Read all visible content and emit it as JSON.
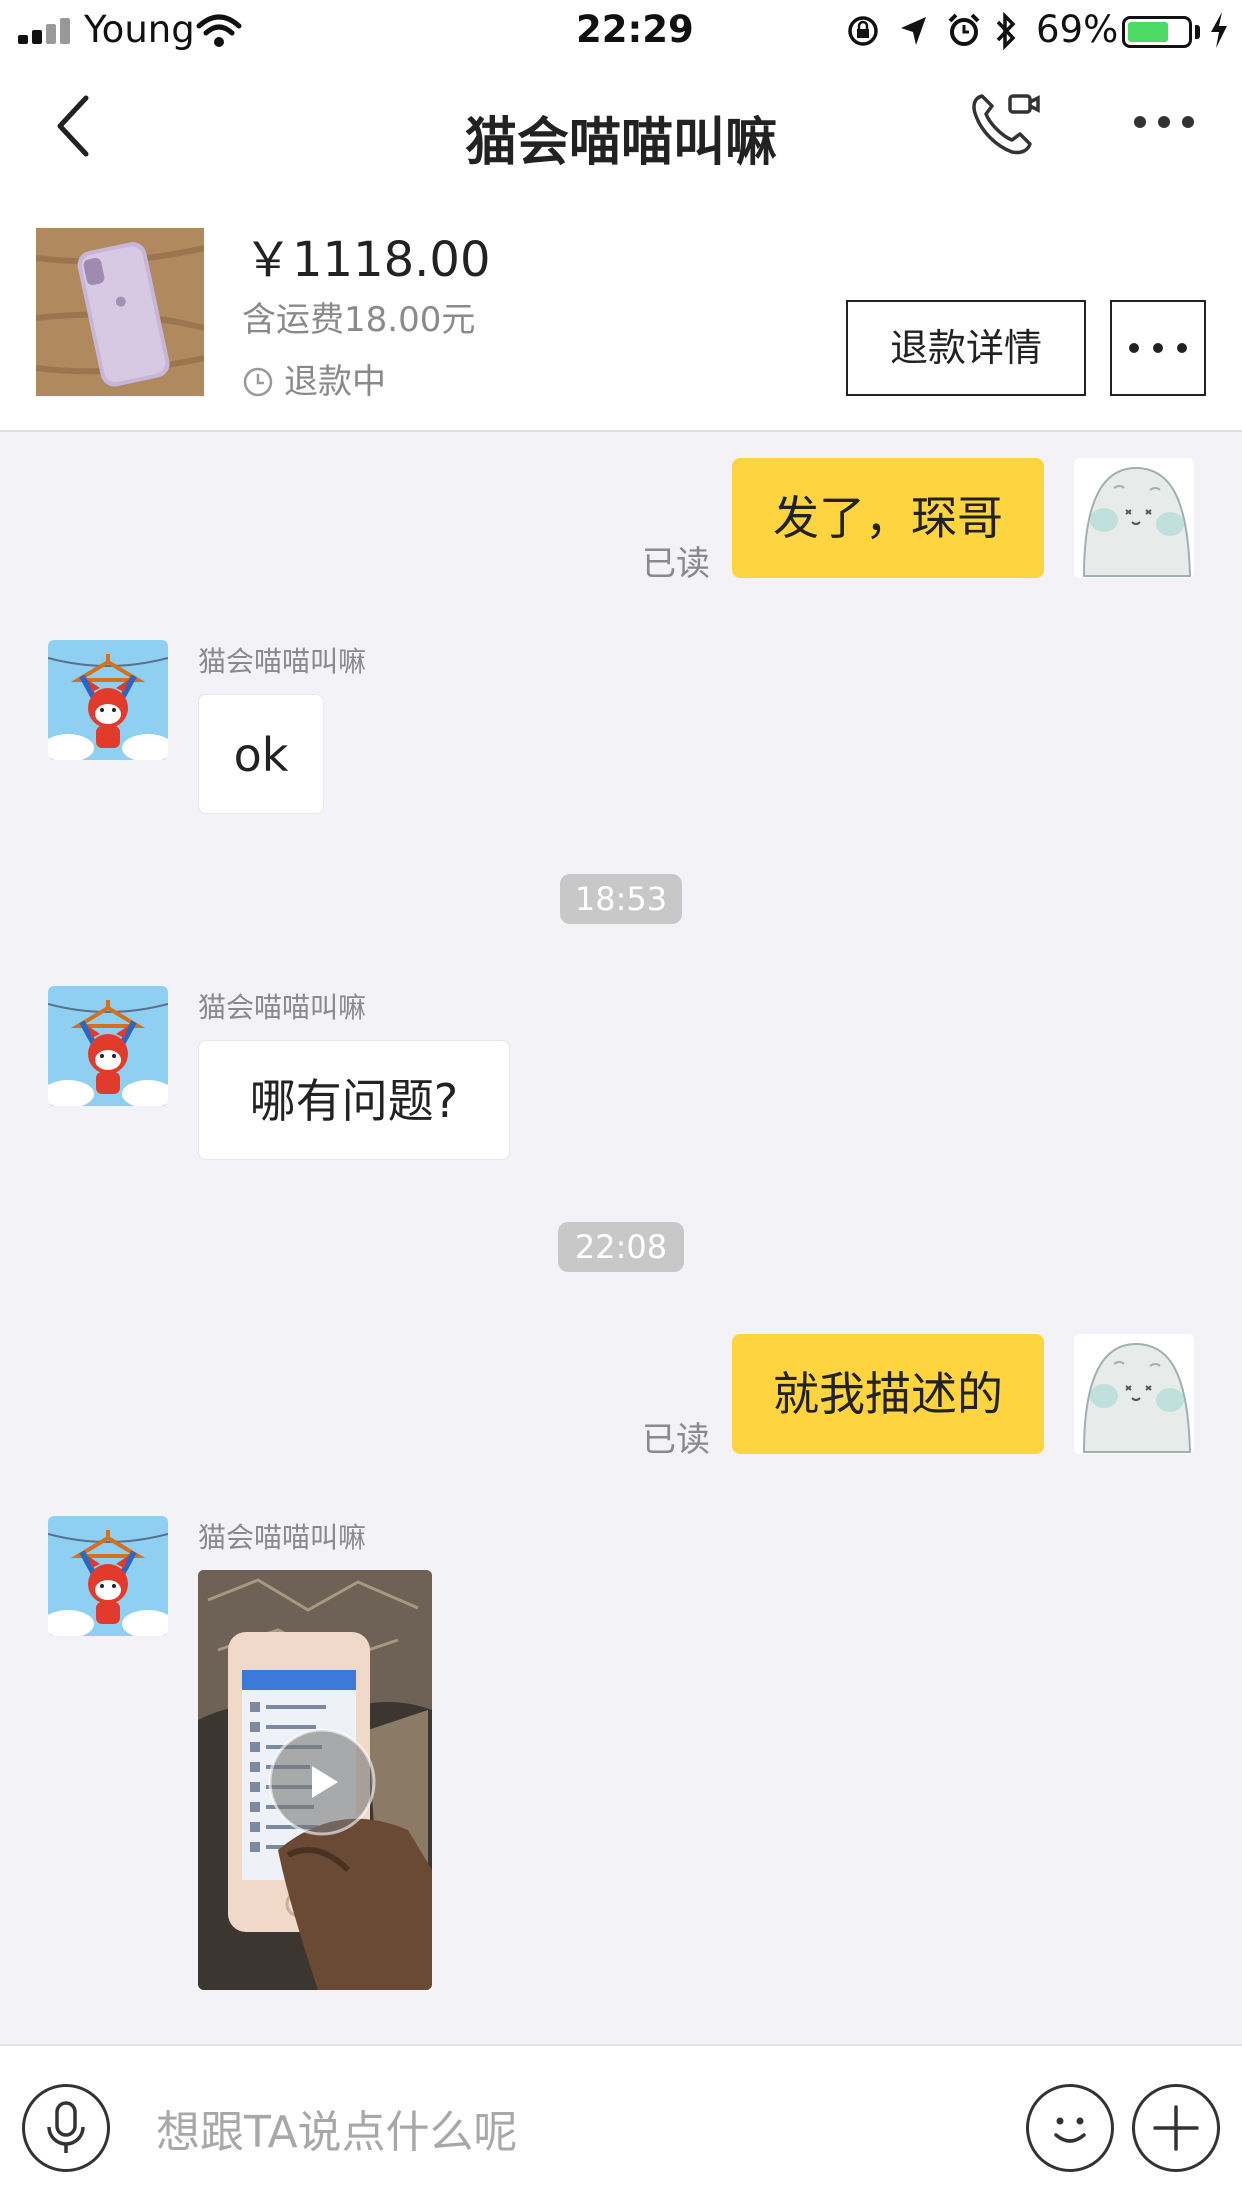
{
  "status_bar": {
    "carrier": "Young",
    "time": "22:29",
    "battery_percent": "69%",
    "battery_level": 0.69,
    "battery_color": "#4cd964"
  },
  "nav": {
    "title": "猫会喵喵叫嘛"
  },
  "order": {
    "price": "￥1118.00",
    "shipping": "含运费18.00元",
    "status": "退款中",
    "refund_button": "退款详情"
  },
  "messages": [
    {
      "side": "me",
      "text": "发了，琛哥",
      "read": "已读"
    },
    {
      "side": "them",
      "sender": "猫会喵喵叫嘛",
      "text": "ok"
    },
    {
      "timestamp": "18:53"
    },
    {
      "side": "them",
      "sender": "猫会喵喵叫嘛",
      "text": "哪有问题?"
    },
    {
      "timestamp": "22:08"
    },
    {
      "side": "me",
      "text": "就我描述的",
      "read": "已读"
    },
    {
      "side": "them",
      "sender": "猫会喵喵叫嘛",
      "type": "video"
    }
  ],
  "input": {
    "placeholder": "想跟TA说点什么呢"
  },
  "colors": {
    "my_bubble": "#fed53f",
    "chat_background": "#f2f2f7"
  }
}
